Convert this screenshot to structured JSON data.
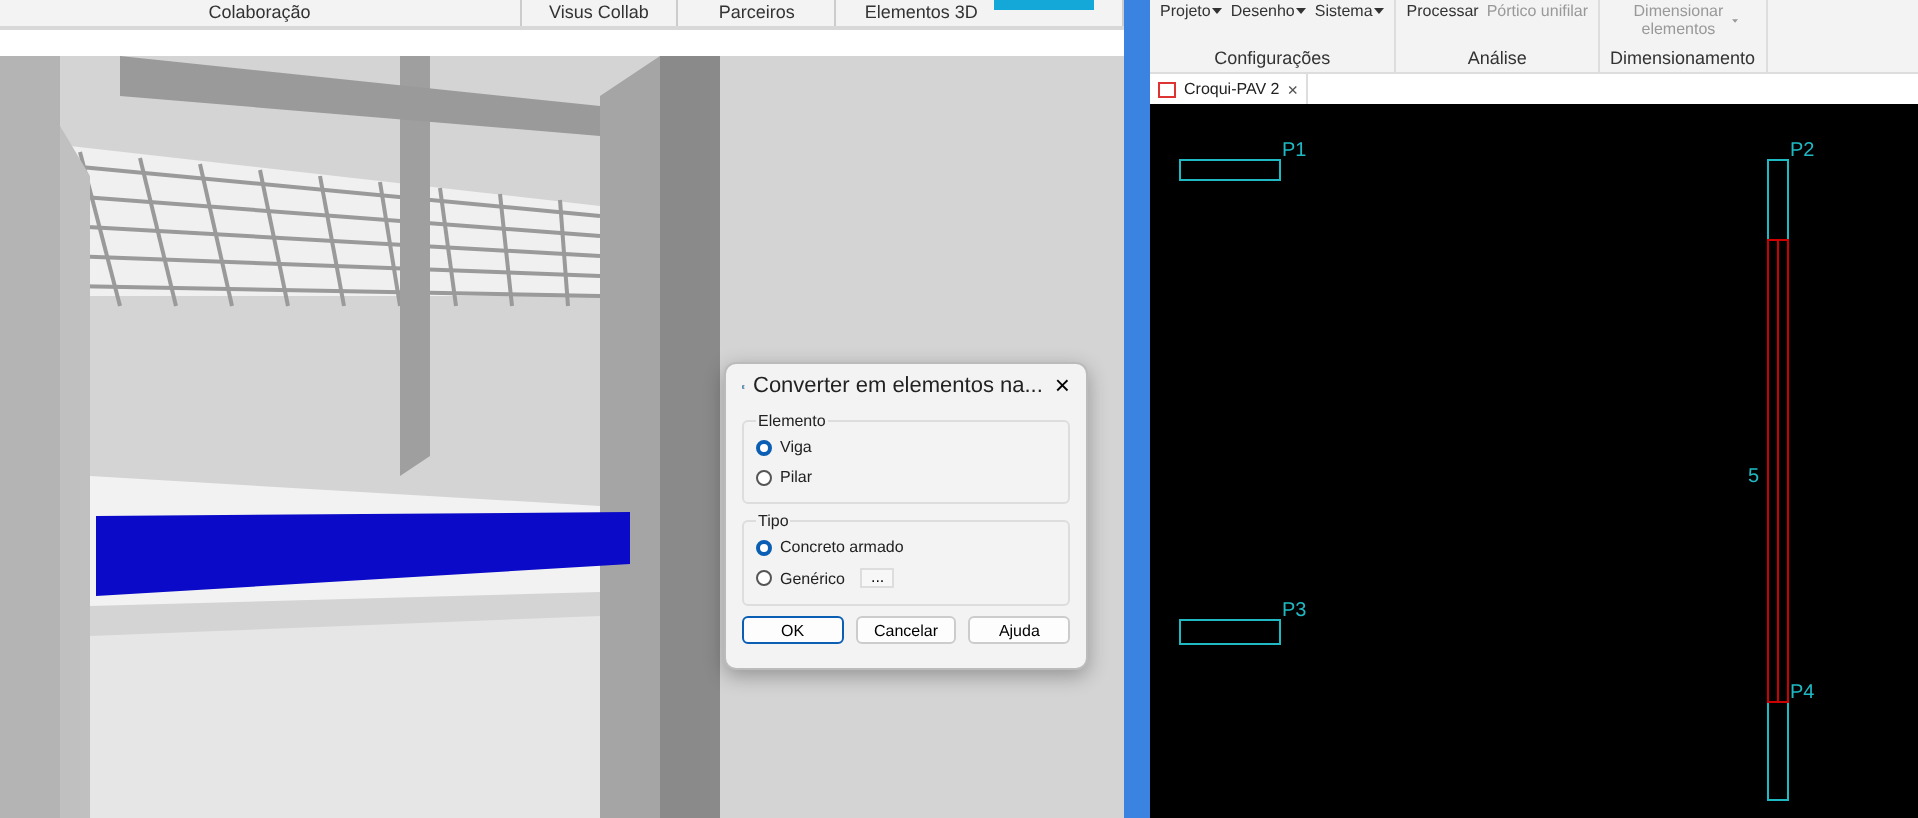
{
  "left_ribbon": {
    "groups": [
      "Colaboração",
      "Visus Collab",
      "Parceiros",
      "Elementos 3D"
    ]
  },
  "dialog": {
    "title": "Converter em elementos na...",
    "close": "×",
    "sections": [
      {
        "label": "Elemento",
        "options": [
          {
            "label": "Viga",
            "selected": true
          },
          {
            "label": "Pilar",
            "selected": false
          }
        ]
      },
      {
        "label": "Tipo",
        "options": [
          {
            "label": "Concreto armado",
            "selected": true
          },
          {
            "label": "Genérico",
            "selected": false,
            "extra": "..."
          }
        ]
      }
    ],
    "buttons": [
      {
        "label": "OK",
        "default": true
      },
      {
        "label": "Cancelar",
        "default": false
      },
      {
        "label": "Ajuda",
        "default": false
      }
    ]
  },
  "right_ribbon": {
    "groups": [
      {
        "label": "Configurações",
        "items": [
          {
            "label": "Projeto",
            "disabled": false,
            "dropdown": true
          },
          {
            "label": "Desenho",
            "disabled": false,
            "dropdown": true
          },
          {
            "label": "Sistema",
            "disabled": false,
            "dropdown": true
          }
        ]
      },
      {
        "label": "Análise",
        "items": [
          {
            "label": "Processar",
            "disabled": false,
            "dropdown": false
          },
          {
            "label": "Pórtico unifilar",
            "disabled": true,
            "dropdown": false
          }
        ]
      },
      {
        "label": "Dimensionamento",
        "items": [
          {
            "label": "Dimensionar elementos",
            "disabled": true,
            "dropdown": true
          }
        ]
      }
    ]
  },
  "document_tab": {
    "label": "Croqui-PAV 2",
    "close": "×"
  },
  "drawing": {
    "pillars": [
      {
        "label": "P1"
      },
      {
        "label": "P2"
      },
      {
        "label": "P3"
      },
      {
        "label": "P4"
      }
    ],
    "beam_label": "5"
  }
}
